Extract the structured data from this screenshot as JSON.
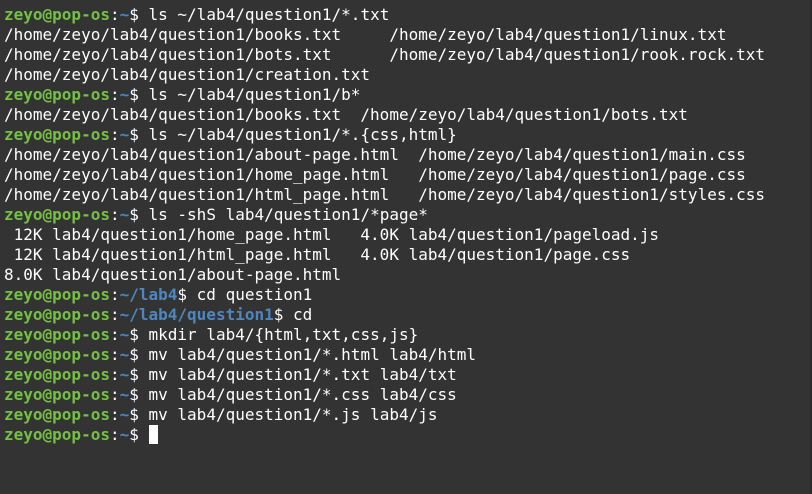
{
  "prompt": {
    "user_host": "zeyo@pop-os",
    "colon": ":",
    "dollar": "$ "
  },
  "lines": [
    {
      "type": "cmd",
      "path": "~",
      "cmd": "ls ~/lab4/question1/*.txt"
    },
    {
      "type": "out",
      "text": "/home/zeyo/lab4/question1/books.txt     /home/zeyo/lab4/question1/linux.txt"
    },
    {
      "type": "out",
      "text": "/home/zeyo/lab4/question1/bots.txt      /home/zeyo/lab4/question1/rook.rock.txt"
    },
    {
      "type": "out",
      "text": "/home/zeyo/lab4/question1/creation.txt"
    },
    {
      "type": "cmd",
      "path": "~",
      "cmd": "ls ~/lab4/question1/b*"
    },
    {
      "type": "out",
      "text": "/home/zeyo/lab4/question1/books.txt  /home/zeyo/lab4/question1/bots.txt"
    },
    {
      "type": "cmd",
      "path": "~",
      "cmd": "ls ~/lab4/question1/*.{css,html}"
    },
    {
      "type": "out",
      "text": "/home/zeyo/lab4/question1/about-page.html  /home/zeyo/lab4/question1/main.css"
    },
    {
      "type": "out",
      "text": "/home/zeyo/lab4/question1/home_page.html   /home/zeyo/lab4/question1/page.css"
    },
    {
      "type": "out",
      "text": "/home/zeyo/lab4/question1/html_page.html   /home/zeyo/lab4/question1/styles.css"
    },
    {
      "type": "cmd",
      "path": "~",
      "cmd": "ls -shS lab4/question1/*page*"
    },
    {
      "type": "out",
      "text": " 12K lab4/question1/home_page.html   4.0K lab4/question1/pageload.js"
    },
    {
      "type": "out",
      "text": " 12K lab4/question1/html_page.html   4.0K lab4/question1/page.css"
    },
    {
      "type": "out",
      "text": "8.0K lab4/question1/about-page.html"
    },
    {
      "type": "cmd",
      "path": "~/lab4",
      "cmd": "cd question1"
    },
    {
      "type": "cmd",
      "path": "~/lab4/question1",
      "cmd": "cd"
    },
    {
      "type": "cmd",
      "path": "~",
      "cmd": "mkdir lab4/{html,txt,css,js}"
    },
    {
      "type": "cmd",
      "path": "~",
      "cmd": "mv lab4/question1/*.html lab4/html"
    },
    {
      "type": "cmd",
      "path": "~",
      "cmd": "mv lab4/question1/*.txt lab4/txt"
    },
    {
      "type": "cmd",
      "path": "~",
      "cmd": "mv lab4/question1/*.css lab4/css"
    },
    {
      "type": "cmd",
      "path": "~",
      "cmd": "mv lab4/question1/*.js lab4/js"
    },
    {
      "type": "cursor",
      "path": "~",
      "cmd": ""
    }
  ]
}
